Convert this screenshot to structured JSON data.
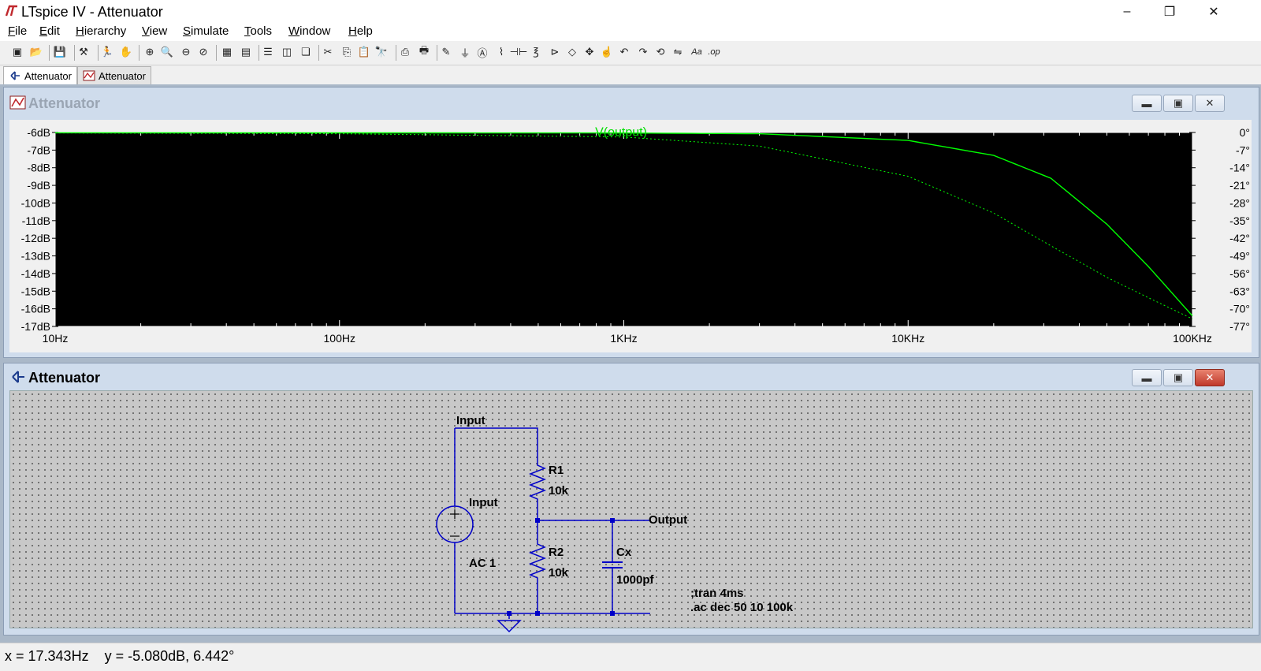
{
  "app": {
    "title": "LTspice IV - Attenuator",
    "window_controls": {
      "minimize": "–",
      "maximize": "❐",
      "close": "✕"
    }
  },
  "menu": [
    "File",
    "Edit",
    "Hierarchy",
    "View",
    "Simulate",
    "Tools",
    "Window",
    "Help"
  ],
  "toolbar_icons": [
    "new-schematic-icon",
    "open-icon",
    "save-icon",
    "control-panel-icon",
    "run-icon",
    "halt-icon",
    "zoom-in-icon",
    "zoom-area-icon",
    "zoom-out-icon",
    "zoom-cancel-icon",
    "autorange-icon",
    "grid-icon",
    "tile-horizontal-icon",
    "tile-vertical-icon",
    "cascade-icon",
    "cut-icon",
    "copy-icon",
    "paste-icon",
    "find-icon",
    "print-setup-icon",
    "print-icon",
    "wire-icon",
    "ground-icon",
    "label-net-icon",
    "resistor-icon",
    "capacitor-icon",
    "inductor-icon",
    "diode-icon",
    "component-icon",
    "move-icon",
    "drag-icon",
    "undo-icon",
    "redo-icon",
    "rotate-icon",
    "mirror-icon",
    "text-icon",
    "spice-directive-icon"
  ],
  "tabs": [
    {
      "label": "Attenuator",
      "icon": "schematic-icon",
      "active": true
    },
    {
      "label": "Attenuator",
      "icon": "waveform-icon",
      "active": false
    }
  ],
  "plot_window": {
    "title": "Attenuator",
    "trace_label": "V(output)",
    "colors": {
      "background": "#000000",
      "trace": "#00ff00",
      "frame": "#ffffff"
    },
    "chart_data": {
      "type": "line",
      "xscale": "log",
      "xlim": [
        10,
        100000
      ],
      "x_ticks": [
        "10Hz",
        "100Hz",
        "1KHz",
        "10KHz",
        "100KHz"
      ],
      "y_left_ticks": [
        "-6dB",
        "-7dB",
        "-8dB",
        "-9dB",
        "-10dB",
        "-11dB",
        "-12dB",
        "-13dB",
        "-14dB",
        "-15dB",
        "-16dB",
        "-17dB"
      ],
      "y_left_lim": [
        -17,
        -6
      ],
      "y_right_ticks": [
        "0°",
        "-7°",
        "-14°",
        "-21°",
        "-28°",
        "-35°",
        "-42°",
        "-49°",
        "-56°",
        "-63°",
        "-70°",
        "-77°"
      ],
      "y_right_lim": [
        -77,
        0
      ],
      "series": [
        {
          "name": "V(output)",
          "axis": "left",
          "style": "solid",
          "x": [
            10,
            100,
            1000,
            3000,
            10000,
            20000,
            31800,
            50000,
            70000,
            100000
          ],
          "y": [
            -6.02,
            -6.02,
            -6.03,
            -6.07,
            -6.45,
            -7.3,
            -8.6,
            -11.2,
            -13.6,
            -16.4
          ]
        },
        {
          "axis": "right",
          "style": "dotted",
          "x": [
            10,
            100,
            1000,
            3000,
            10000,
            20000,
            31800,
            50000,
            70000,
            100000
          ],
          "y": [
            -0.2,
            -0.5,
            -1.8,
            -5.4,
            -17.4,
            -32,
            -45,
            -57.5,
            -65.6,
            -74
          ]
        }
      ]
    }
  },
  "schematic_window": {
    "title": "Attenuator",
    "labels": {
      "input_net": "Input",
      "source_name": "Input",
      "source_value": "AC 1",
      "r1_name": "R1",
      "r1_value": "10k",
      "r2_name": "R2",
      "r2_value": "10k",
      "cx_name": "Cx",
      "cx_value": "1000pf",
      "output_net": "Output",
      "directive_1": ";tran 4ms",
      "directive_2": ".ac dec 50 10 100k"
    },
    "colors": {
      "wire": "#0000c8",
      "background": "#c8c8c8"
    }
  },
  "status": {
    "text": "x = 17.343Hz    y = -5.080dB, 6.442°"
  }
}
